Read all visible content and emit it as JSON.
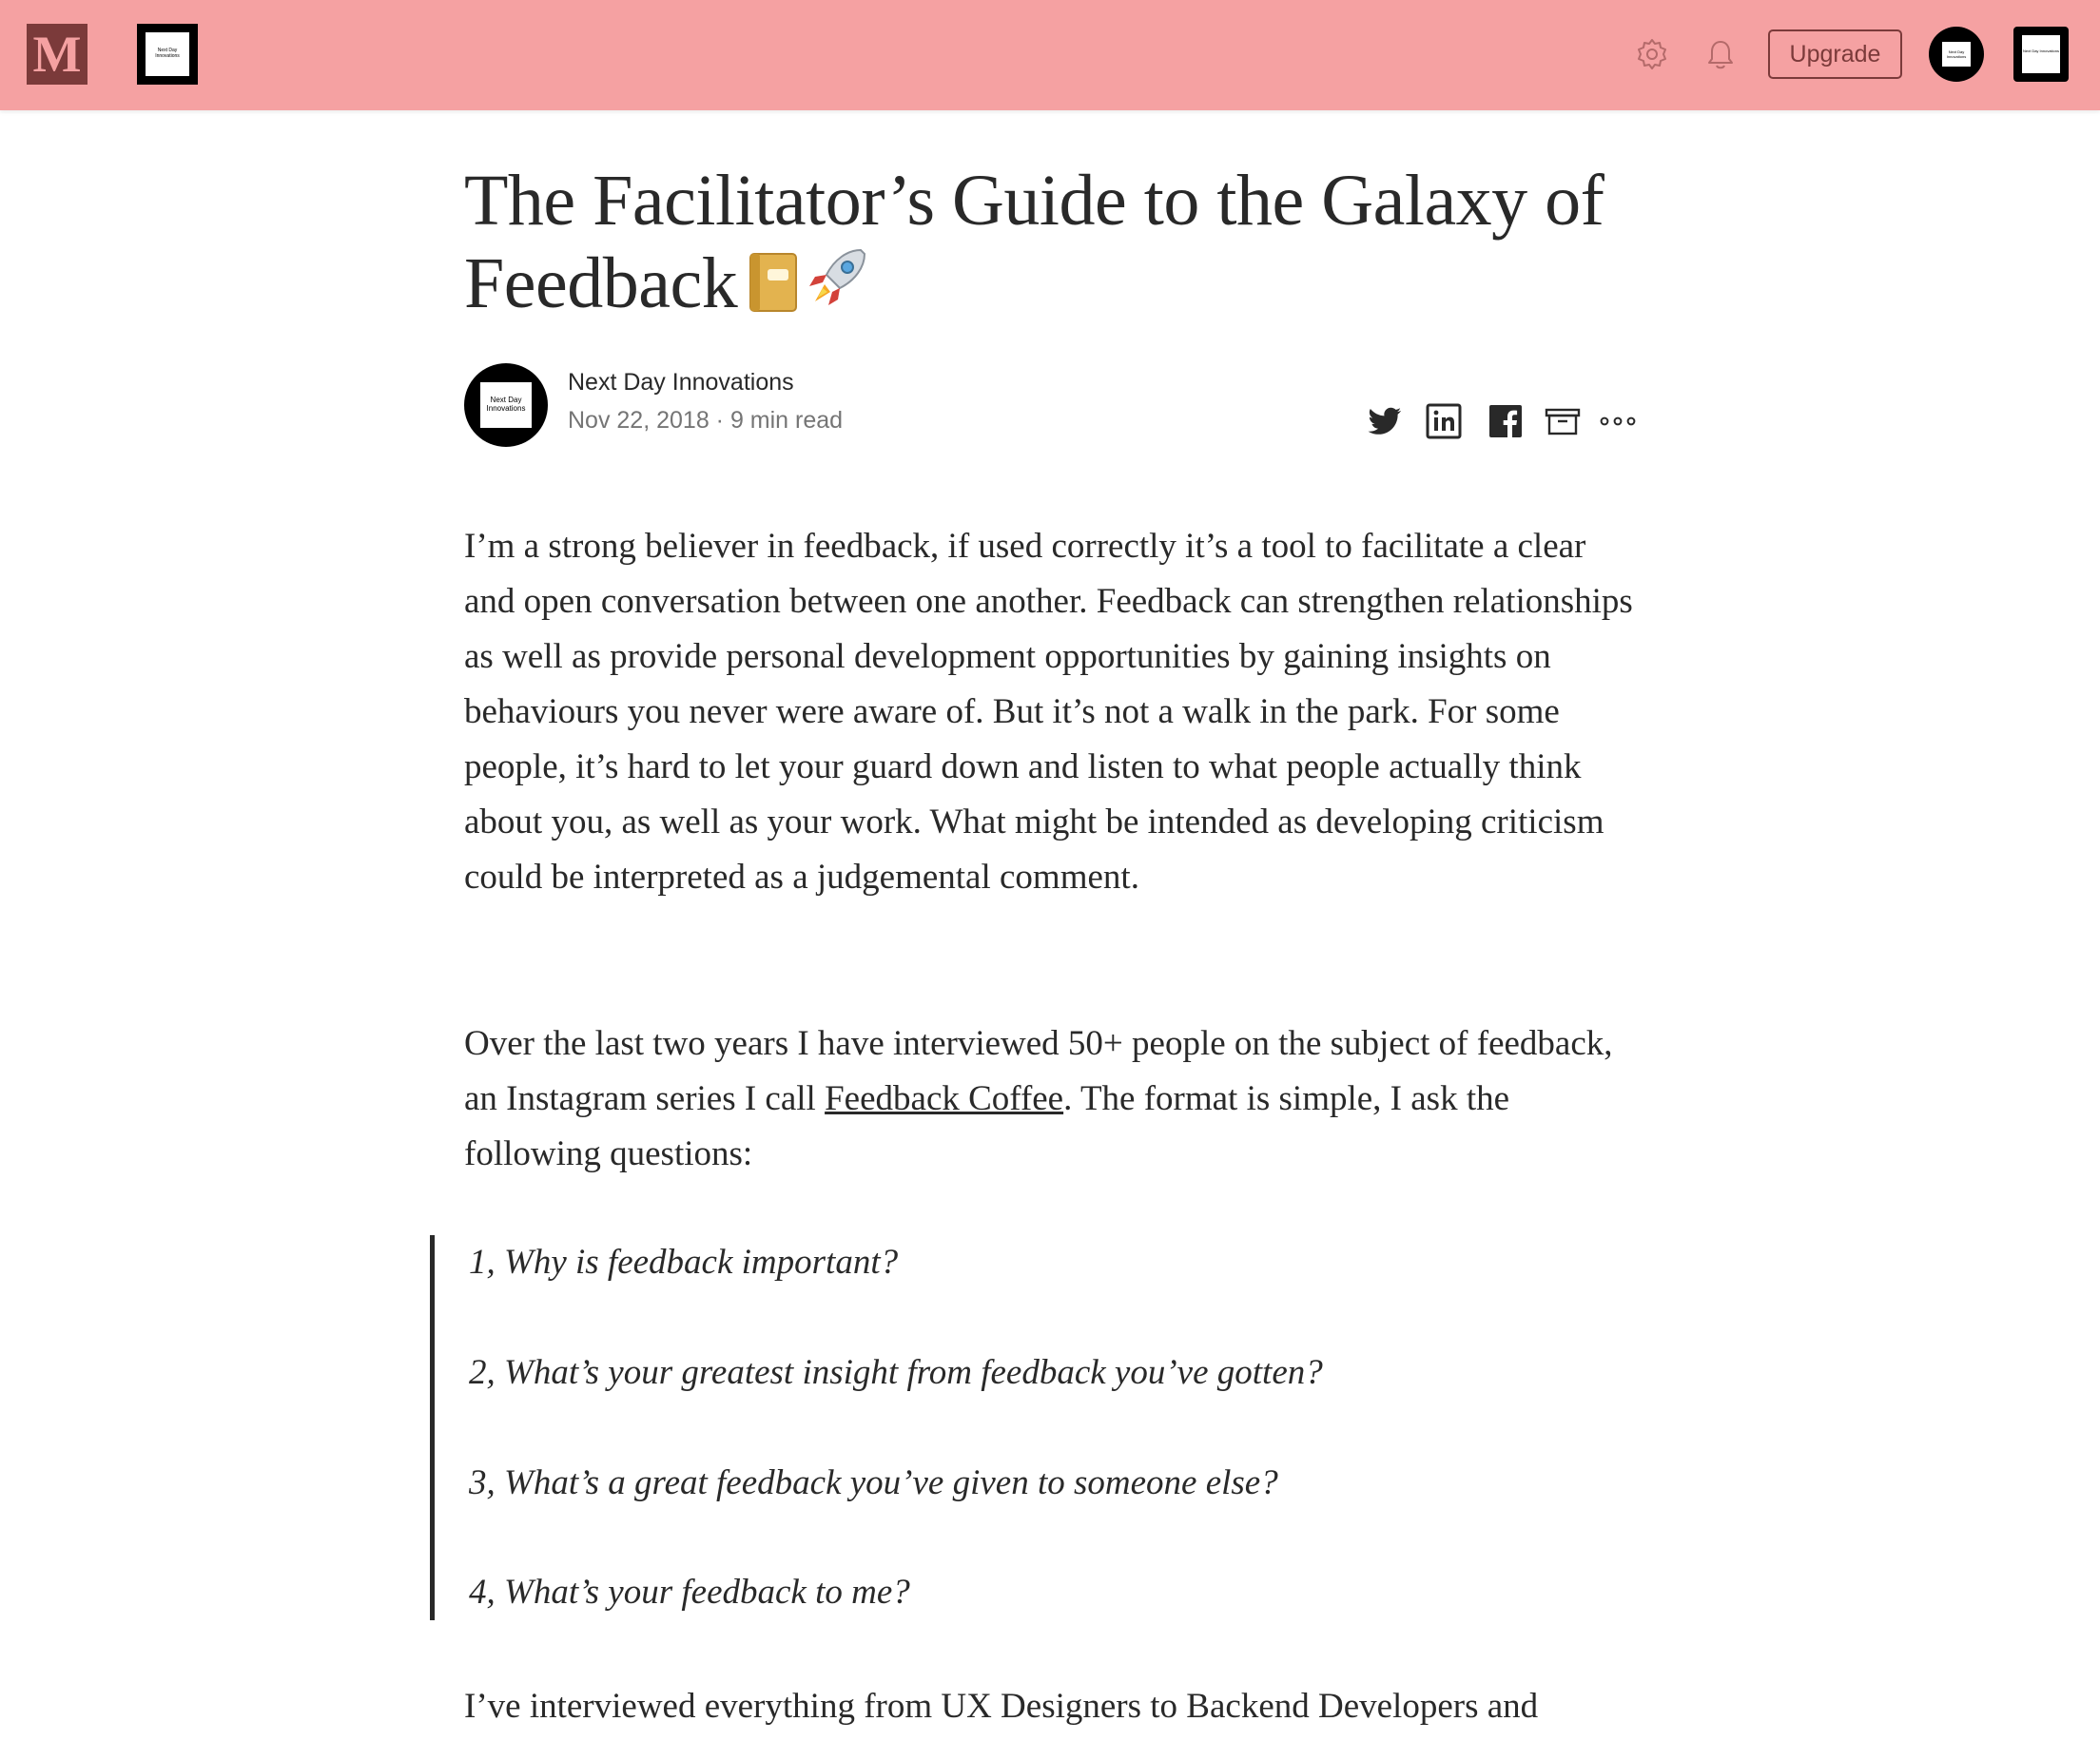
{
  "topbar": {
    "logo_letter": "M",
    "publication_logo_text": "Next Day Innovations",
    "upgrade_label": "Upgrade",
    "profile_logo_text": "Next Day Innovations",
    "icons": [
      "settings-icon",
      "bell-icon"
    ],
    "background_color": "#f5a1a2",
    "accent_color": "#7b3a3a"
  },
  "article": {
    "title": "The Facilitator’s Guide to the Galaxy of Feedback",
    "title_emojis": [
      "notebook-emoji",
      "rocket-emoji"
    ],
    "author": {
      "name": "Next Day Innovations",
      "avatar_text": "Next Day Innovations",
      "date": "Nov 22, 2018",
      "separator": "·",
      "read_time": "9 min read"
    },
    "share_icons": [
      "twitter-icon",
      "linkedin-icon",
      "facebook-icon",
      "bookmark-icon",
      "more-icon"
    ],
    "paragraph1": "I’m a strong believer in feedback, if used correctly it’s a tool to facilitate a clear and open conversation between one another. Feedback can strengthen relationships as well as provide personal development opportunities by gaining insights on behaviours you never were aware of. But it’s not a walk in the park. For some people, it’s hard to let your guard down and listen to what people actually think about you, as well as your work. What might be intended as developing criticism could be interpreted as a judgemental comment.",
    "paragraph2_before": "Over the last two years I have interviewed 50+ people on the subject of feedback, an Instagram series I call ",
    "paragraph2_link": "Feedback Coffee",
    "paragraph2_after": ". The format is simple, I ask the following questions:",
    "questions": [
      "1, Why is feedback important?",
      "2, What’s your greatest insight from feedback you’ve gotten?",
      "3, What’s a great feedback you’ve given to someone else?",
      "4, What’s your feedback to me?"
    ],
    "paragraph3": "I’ve interviewed everything from UX Designers to Backend Developers and"
  }
}
